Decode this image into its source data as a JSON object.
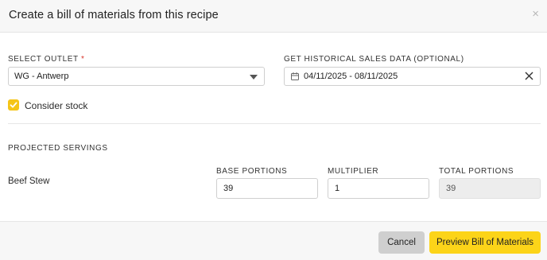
{
  "dialog": {
    "title": "Create a bill of materials from this recipe",
    "close_glyph": "×"
  },
  "outlet": {
    "label": "SELECT OUTLET",
    "required_mark": "*",
    "value": "WG - Antwerp"
  },
  "sales_data": {
    "label": "GET HISTORICAL SALES DATA (OPTIONAL)",
    "value": "04/11/2025 - 08/11/2025"
  },
  "consider_stock": {
    "label": "Consider stock",
    "checked": true
  },
  "projected": {
    "label": "PROJECTED SERVINGS",
    "columns": {
      "base": "BASE PORTIONS",
      "multiplier": "MULTIPLIER",
      "total": "TOTAL PORTIONS"
    },
    "row": {
      "name": "Beef Stew",
      "base": "39",
      "multiplier": "1",
      "total": "39"
    }
  },
  "footer": {
    "cancel_label": "Cancel",
    "preview_label": "Preview Bill of Materials"
  },
  "colors": {
    "accent": "#fcd419",
    "checkbox": "#f5c518",
    "required": "#d9342b"
  },
  "icons": {
    "close": "close-icon",
    "caret": "chevron-down-icon",
    "calendar": "calendar-icon",
    "clear": "clear-icon",
    "check": "check-icon"
  }
}
